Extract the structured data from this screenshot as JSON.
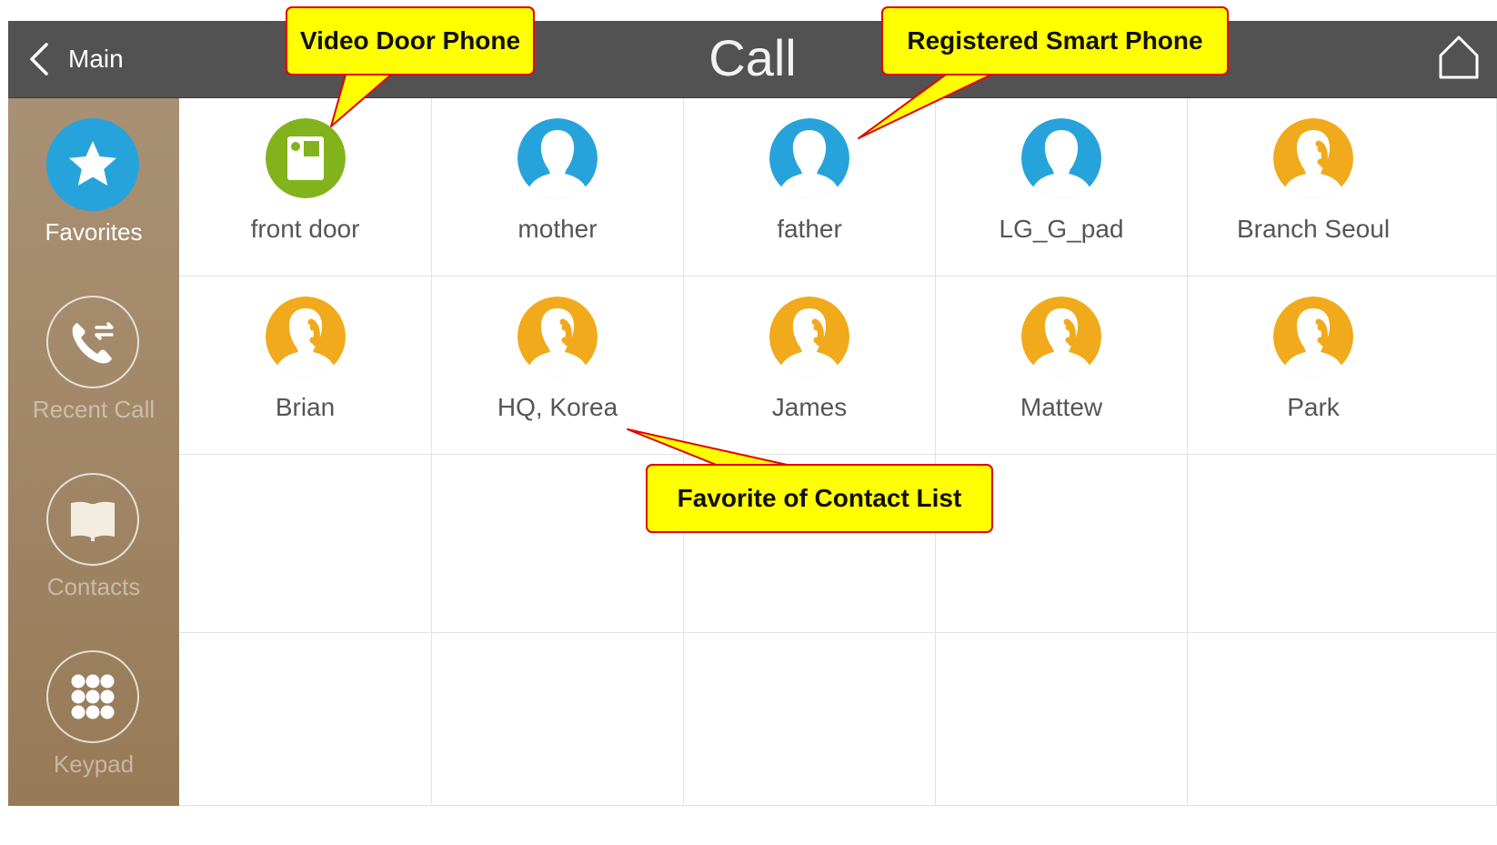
{
  "header": {
    "back_label": "Main",
    "title": "Call"
  },
  "icons": {
    "back": "chevron-left-icon",
    "home": "home-icon"
  },
  "sidebar": {
    "items": [
      {
        "key": "favorites",
        "label": "Favorites",
        "icon": "star-icon",
        "active": true
      },
      {
        "key": "recent-call",
        "label": "Recent Call",
        "icon": "phone-transfer-icon",
        "active": false
      },
      {
        "key": "contacts",
        "label": "Contacts",
        "icon": "book-icon",
        "active": false
      },
      {
        "key": "keypad",
        "label": "Keypad",
        "icon": "keypad-dots-icon",
        "active": false
      }
    ]
  },
  "contacts": [
    {
      "name": "front door",
      "type": "door-phone",
      "icon": "door-phone-icon",
      "color": "#82b31d"
    },
    {
      "name": "mother",
      "type": "smartphone",
      "icon": "person-icon",
      "color": "#27a3dc"
    },
    {
      "name": "father",
      "type": "smartphone",
      "icon": "person-icon",
      "color": "#27a3dc"
    },
    {
      "name": "LG_G_pad",
      "type": "smartphone",
      "icon": "person-icon",
      "color": "#27a3dc"
    },
    {
      "name": "Branch Seoul",
      "type": "contact",
      "icon": "person-phone-icon",
      "color": "#f0aa1b"
    },
    {
      "name": "Brian",
      "type": "contact",
      "icon": "person-phone-icon",
      "color": "#f0aa1b"
    },
    {
      "name": "HQ, Korea",
      "type": "contact",
      "icon": "person-phone-icon",
      "color": "#f0aa1b"
    },
    {
      "name": "James",
      "type": "contact",
      "icon": "person-phone-icon",
      "color": "#f0aa1b"
    },
    {
      "name": "Mattew",
      "type": "contact",
      "icon": "person-phone-icon",
      "color": "#f0aa1b"
    },
    {
      "name": "Park",
      "type": "contact",
      "icon": "person-phone-icon",
      "color": "#f0aa1b"
    }
  ],
  "annotations": {
    "video_door_phone": "Video Door Phone",
    "registered_smart_phone": "Registered Smart Phone",
    "favorite_of_contact_list": "Favorite of Contact List"
  },
  "colors": {
    "header_bg": "#525252",
    "active_blue": "#27a3dc",
    "door_green": "#82b31d",
    "contact_orange": "#f0aa1b",
    "callout_fill": "#ffff00",
    "callout_border": "#e30000"
  }
}
